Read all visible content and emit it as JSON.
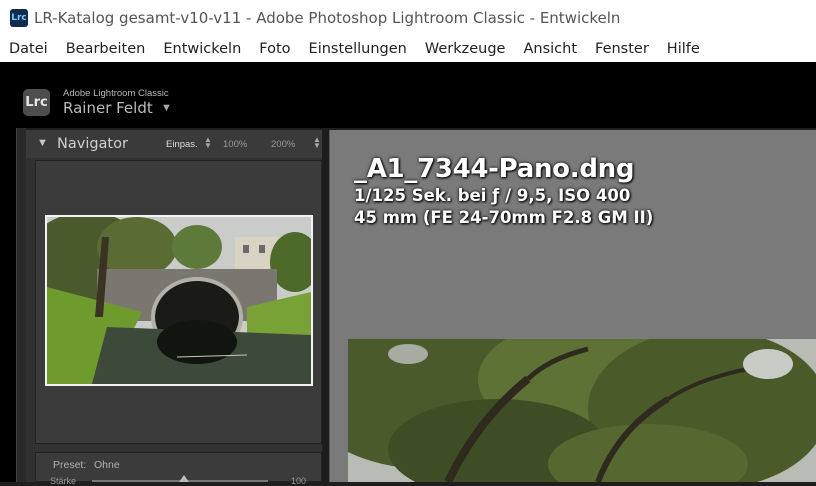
{
  "window": {
    "icon_label": "Lrc",
    "title": "LR-Katalog gesamt-v10-v11 - Adobe Photoshop Lightroom Classic - Entwickeln"
  },
  "menu": [
    "Datei",
    "Bearbeiten",
    "Entwickeln",
    "Foto",
    "Einstellungen",
    "Werkzeuge",
    "Ansicht",
    "Fenster",
    "Hilfe"
  ],
  "identity": {
    "badge": "Lrc",
    "product": "Adobe Lightroom Classic",
    "user": "Rainer Feldt",
    "arrow": "▼"
  },
  "navigator": {
    "collapse_icon": "▼",
    "title": "Navigator",
    "zoom_fit": "Einpas.",
    "zoom_100": "100%",
    "zoom_200": "200%"
  },
  "presets": {
    "preset_label": "Preset:",
    "preset_value": "Ohne",
    "amount_label": "Stärke",
    "amount_value": "100",
    "amount_fraction": 0.52
  },
  "photo": {
    "filename": "_A1_7344-Pano.dng",
    "exposure_line": "1/125 Sek. bei ƒ / 9,5, ISO 400",
    "lens_line": "45 mm (FE 24-70mm F2.8 GM II)"
  },
  "colors": {
    "panel_bg": "#313131",
    "main_bg": "#7a7a7a",
    "identity_bg": "#000000",
    "titlebar_bg": "#ffffff"
  }
}
